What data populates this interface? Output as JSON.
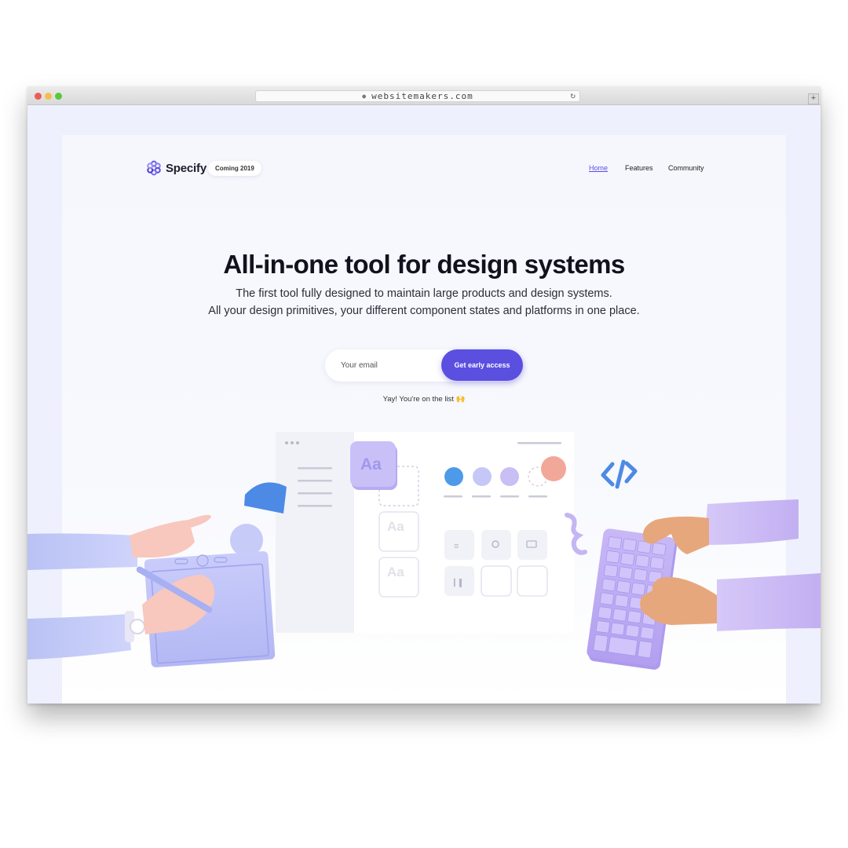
{
  "browser": {
    "url": "websitemakers.com",
    "new_tab_label": "+"
  },
  "header": {
    "brand": "Specify",
    "badge": "Coming 2019",
    "nav": [
      {
        "label": "Home",
        "active": true
      },
      {
        "label": "Features",
        "active": false
      },
      {
        "label": "Community",
        "active": false
      }
    ]
  },
  "hero": {
    "title": "All-in-one tool for design systems",
    "subtitle_line1": "The first tool fully designed to maintain large products and design systems.",
    "subtitle_line2": "All your design primitives, your different component states and platforms in one place."
  },
  "signup": {
    "email_placeholder": "Your email",
    "button_label": "Get early access",
    "confirmation": "Yay! You're on the list 🙌"
  },
  "illustration": {
    "type_sample": "Aa",
    "swatch_colors": [
      "#4d9be8",
      "#c5c7f7",
      "#c9bff5",
      "#f2a898"
    ]
  },
  "colors": {
    "accent": "#5b4fe0",
    "page_bg": "#eef1fd"
  }
}
